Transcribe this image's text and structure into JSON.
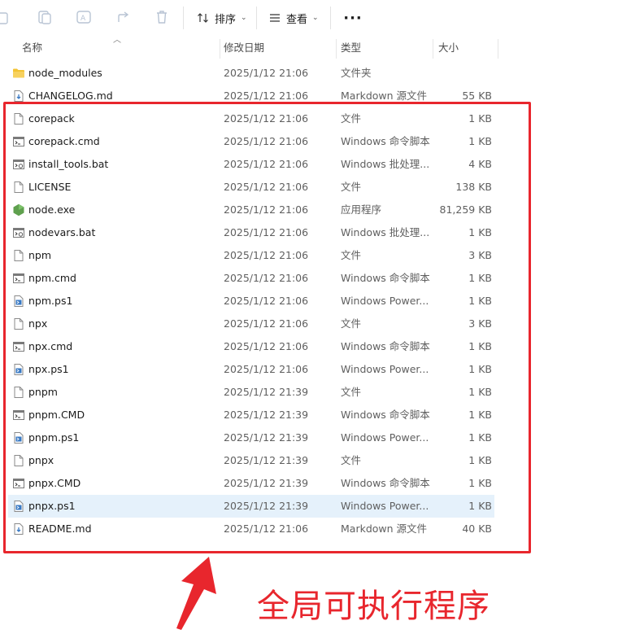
{
  "toolbar": {
    "sort_label": "排序",
    "view_label": "查看",
    "more_label": "···"
  },
  "columns": {
    "name": "名称",
    "date": "修改日期",
    "type": "类型",
    "size": "大小"
  },
  "files": [
    {
      "name": "node_modules",
      "date": "2025/1/12 21:06",
      "type": "文件夹",
      "size": "",
      "icon": "folder-icon"
    },
    {
      "name": "CHANGELOG.md",
      "date": "2025/1/12 21:06",
      "type": "Markdown 源文件",
      "size": "55 KB",
      "icon": "markdown-file-icon"
    },
    {
      "name": "corepack",
      "date": "2025/1/12 21:06",
      "type": "文件",
      "size": "1 KB",
      "icon": "file-icon"
    },
    {
      "name": "corepack.cmd",
      "date": "2025/1/12 21:06",
      "type": "Windows 命令脚本",
      "size": "1 KB",
      "icon": "cmd-script-icon"
    },
    {
      "name": "install_tools.bat",
      "date": "2025/1/12 21:06",
      "type": "Windows 批处理...",
      "size": "4 KB",
      "icon": "batch-file-icon"
    },
    {
      "name": "LICENSE",
      "date": "2025/1/12 21:06",
      "type": "文件",
      "size": "138 KB",
      "icon": "file-icon"
    },
    {
      "name": "node.exe",
      "date": "2025/1/12 21:06",
      "type": "应用程序",
      "size": "81,259 KB",
      "icon": "nodejs-icon"
    },
    {
      "name": "nodevars.bat",
      "date": "2025/1/12 21:06",
      "type": "Windows 批处理...",
      "size": "1 KB",
      "icon": "batch-file-icon"
    },
    {
      "name": "npm",
      "date": "2025/1/12 21:06",
      "type": "文件",
      "size": "3 KB",
      "icon": "file-icon"
    },
    {
      "name": "npm.cmd",
      "date": "2025/1/12 21:06",
      "type": "Windows 命令脚本",
      "size": "1 KB",
      "icon": "cmd-script-icon"
    },
    {
      "name": "npm.ps1",
      "date": "2025/1/12 21:06",
      "type": "Windows Power...",
      "size": "1 KB",
      "icon": "powershell-file-icon"
    },
    {
      "name": "npx",
      "date": "2025/1/12 21:06",
      "type": "文件",
      "size": "3 KB",
      "icon": "file-icon"
    },
    {
      "name": "npx.cmd",
      "date": "2025/1/12 21:06",
      "type": "Windows 命令脚本",
      "size": "1 KB",
      "icon": "cmd-script-icon"
    },
    {
      "name": "npx.ps1",
      "date": "2025/1/12 21:06",
      "type": "Windows Power...",
      "size": "1 KB",
      "icon": "powershell-file-icon"
    },
    {
      "name": "pnpm",
      "date": "2025/1/12 21:39",
      "type": "文件",
      "size": "1 KB",
      "icon": "file-icon"
    },
    {
      "name": "pnpm.CMD",
      "date": "2025/1/12 21:39",
      "type": "Windows 命令脚本",
      "size": "1 KB",
      "icon": "cmd-script-icon"
    },
    {
      "name": "pnpm.ps1",
      "date": "2025/1/12 21:39",
      "type": "Windows Power...",
      "size": "1 KB",
      "icon": "powershell-file-icon"
    },
    {
      "name": "pnpx",
      "date": "2025/1/12 21:39",
      "type": "文件",
      "size": "1 KB",
      "icon": "file-icon"
    },
    {
      "name": "pnpx.CMD",
      "date": "2025/1/12 21:39",
      "type": "Windows 命令脚本",
      "size": "1 KB",
      "icon": "cmd-script-icon"
    },
    {
      "name": "pnpx.ps1",
      "date": "2025/1/12 21:39",
      "type": "Windows Power...",
      "size": "1 KB",
      "icon": "powershell-file-icon",
      "selected": true
    },
    {
      "name": "README.md",
      "date": "2025/1/12 21:06",
      "type": "Markdown 源文件",
      "size": "40 KB",
      "icon": "markdown-file-icon"
    }
  ],
  "annotation": {
    "caption": "全局可执行程序",
    "color": "#e8262d"
  },
  "colors": {
    "selected_row": "#e5f1fb",
    "folder": "#f3c332",
    "nodejs": "#5fa04e",
    "powershell": "#3a7ac4"
  }
}
